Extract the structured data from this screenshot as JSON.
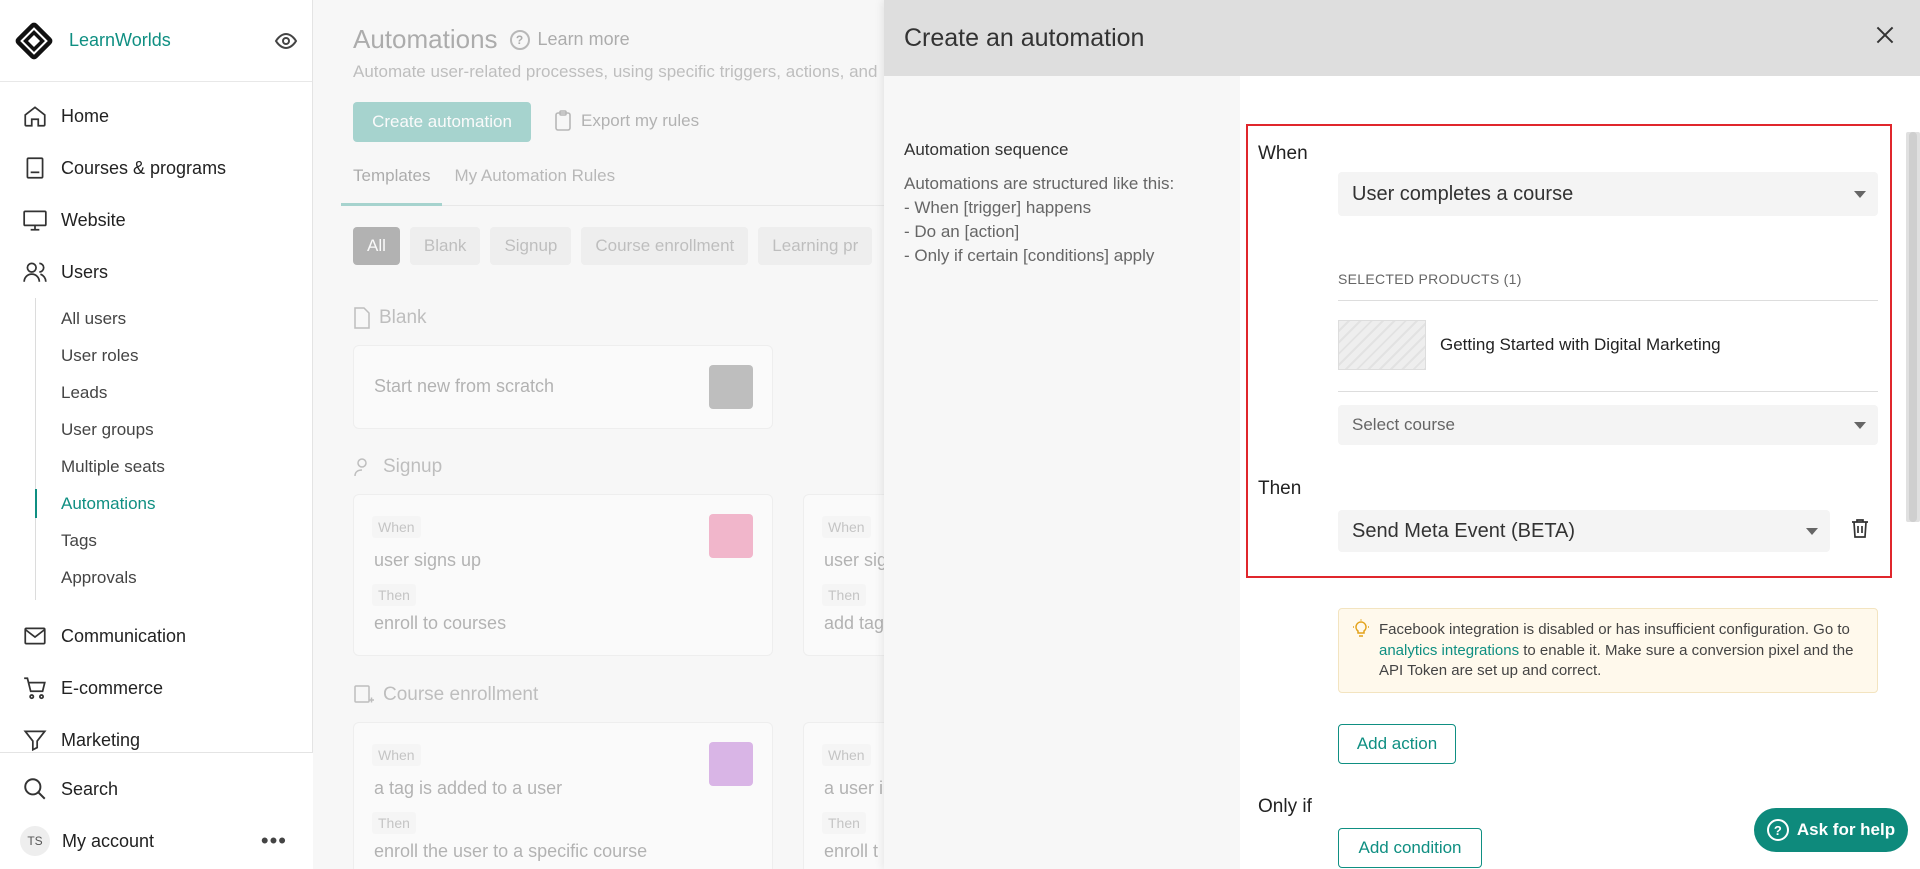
{
  "sidebar": {
    "brand": "LearnWorlds",
    "nav": {
      "home": "Home",
      "courses": "Courses & programs",
      "website": "Website",
      "users": "Users",
      "communication": "Communication",
      "ecommerce": "E-commerce",
      "marketing": "Marketing"
    },
    "users_sub": [
      "All users",
      "User roles",
      "Leads",
      "User groups",
      "Multiple seats",
      "Automations",
      "Tags",
      "Approvals"
    ],
    "active_sub": "Automations",
    "search": "Search",
    "account": {
      "initials": "TS",
      "label": "My account"
    }
  },
  "main": {
    "title": "Automations",
    "learn_more": "Learn more",
    "subtitle": "Automate user-related processes, using specific triggers, actions, and",
    "create_button": "Create automation",
    "export_button": "Export my rules",
    "tabs": [
      "Templates",
      "My Automation Rules"
    ],
    "chips": [
      "All",
      "Blank",
      "Signup",
      "Course enrollment",
      "Learning pr"
    ],
    "sections": {
      "blank": "Blank",
      "signup": "Signup",
      "course_enrollment": "Course enrollment"
    },
    "blank_card": "Start new from scratch",
    "when_label": "When",
    "then_label": "Then",
    "cards": {
      "signup_1": {
        "when": "user signs up",
        "then": "enroll to courses"
      },
      "signup_2": {
        "when": "user sig",
        "then": "add tag"
      },
      "enroll_1": {
        "when": "a tag is added to a user",
        "then": "enroll the user to a specific course"
      },
      "enroll_2": {
        "when": "a user i",
        "then": "enroll t"
      }
    }
  },
  "drawer": {
    "title": "Create an automation",
    "sequence": {
      "title": "Automation sequence",
      "lines": [
        "Automations are structured like this:",
        "- When [trigger] happens",
        "- Do an [action]",
        "- Only if certain [conditions] apply"
      ]
    },
    "when_label": "When",
    "trigger_value": "User completes a course",
    "selected_products_label": "SELECTED PRODUCTS (1)",
    "product_name": "Getting Started with Digital Marketing",
    "select_course_placeholder": "Select course",
    "then_label": "Then",
    "action_value": "Send Meta Event (BETA)",
    "alert": {
      "before": "Facebook integration is disabled or has insufficient configuration. Go to ",
      "link": "analytics integrations",
      "after": " to enable it. Make sure a conversion pixel and the API Token are set up and correct."
    },
    "add_action": "Add action",
    "only_if_label": "Only if",
    "add_condition": "Add condition"
  },
  "ask_help": "Ask for help",
  "colors": {
    "accent": "#0f8f82",
    "highlight": "#e0262c"
  }
}
